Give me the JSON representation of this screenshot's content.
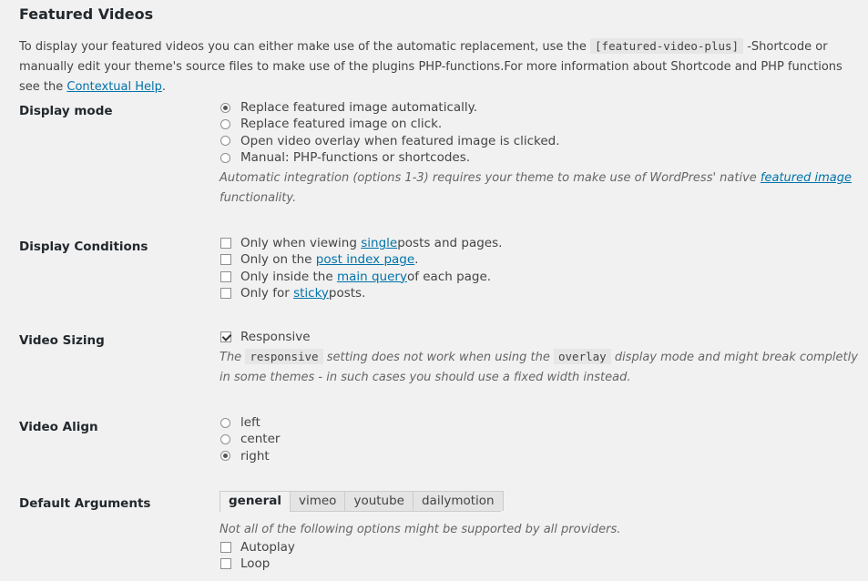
{
  "section": {
    "title": "Featured Videos",
    "intro": {
      "before_code": "To display your featured videos you can either make use of the automatic replacement, use the ",
      "code": "[featured-video-plus]",
      "after_code": " -Shortcode or manually edit your theme's source files to make use of the plugins PHP-functions.For more information about Shortcode and PHP functions see the ",
      "link": "Contextual Help",
      "end": "."
    }
  },
  "display_mode": {
    "label": "Display mode",
    "options": [
      {
        "label": "Replace featured image automatically.",
        "checked": true
      },
      {
        "label": "Replace featured image on click.",
        "checked": false
      },
      {
        "label": "Open video overlay when featured image is clicked.",
        "checked": false
      },
      {
        "label": "Manual: PHP-functions or shortcodes.",
        "checked": false
      }
    ],
    "desc_before": "Automatic integration (options 1-3) requires your theme to make use of WordPress' native ",
    "desc_link": "featured image",
    "desc_after": " functionality."
  },
  "display_conditions": {
    "label": "Display Conditions",
    "options": [
      {
        "before": "Only when viewing ",
        "link": "single",
        "after": " posts and pages.",
        "checked": false
      },
      {
        "before": "Only on the ",
        "link": "post index page",
        "after": ".",
        "checked": false
      },
      {
        "before": "Only inside the ",
        "link": "main query",
        "after": " of each page.",
        "checked": false
      },
      {
        "before": "Only for ",
        "link": "sticky",
        "after": " posts.",
        "checked": false
      }
    ]
  },
  "video_sizing": {
    "label": "Video Sizing",
    "responsive_label": "Responsive",
    "responsive_checked": true,
    "desc_1": "The ",
    "code_1": "responsive",
    "desc_2": " setting does not work when using the ",
    "code_2": "overlay",
    "desc_3": " display mode and might break completly in some themes - in such cases you should use a fixed width instead."
  },
  "video_align": {
    "label": "Video Align",
    "options": [
      {
        "label": "left",
        "checked": false
      },
      {
        "label": "center",
        "checked": false
      },
      {
        "label": "right",
        "checked": true
      }
    ]
  },
  "default_arguments": {
    "label": "Default Arguments",
    "tabs": [
      "general",
      "vimeo",
      "youtube",
      "dailymotion"
    ],
    "active_tab": "general",
    "note": "Not all of the following options might be supported by all providers.",
    "options": [
      {
        "label": "Autoplay",
        "checked": false
      },
      {
        "label": "Loop",
        "checked": false
      }
    ]
  }
}
